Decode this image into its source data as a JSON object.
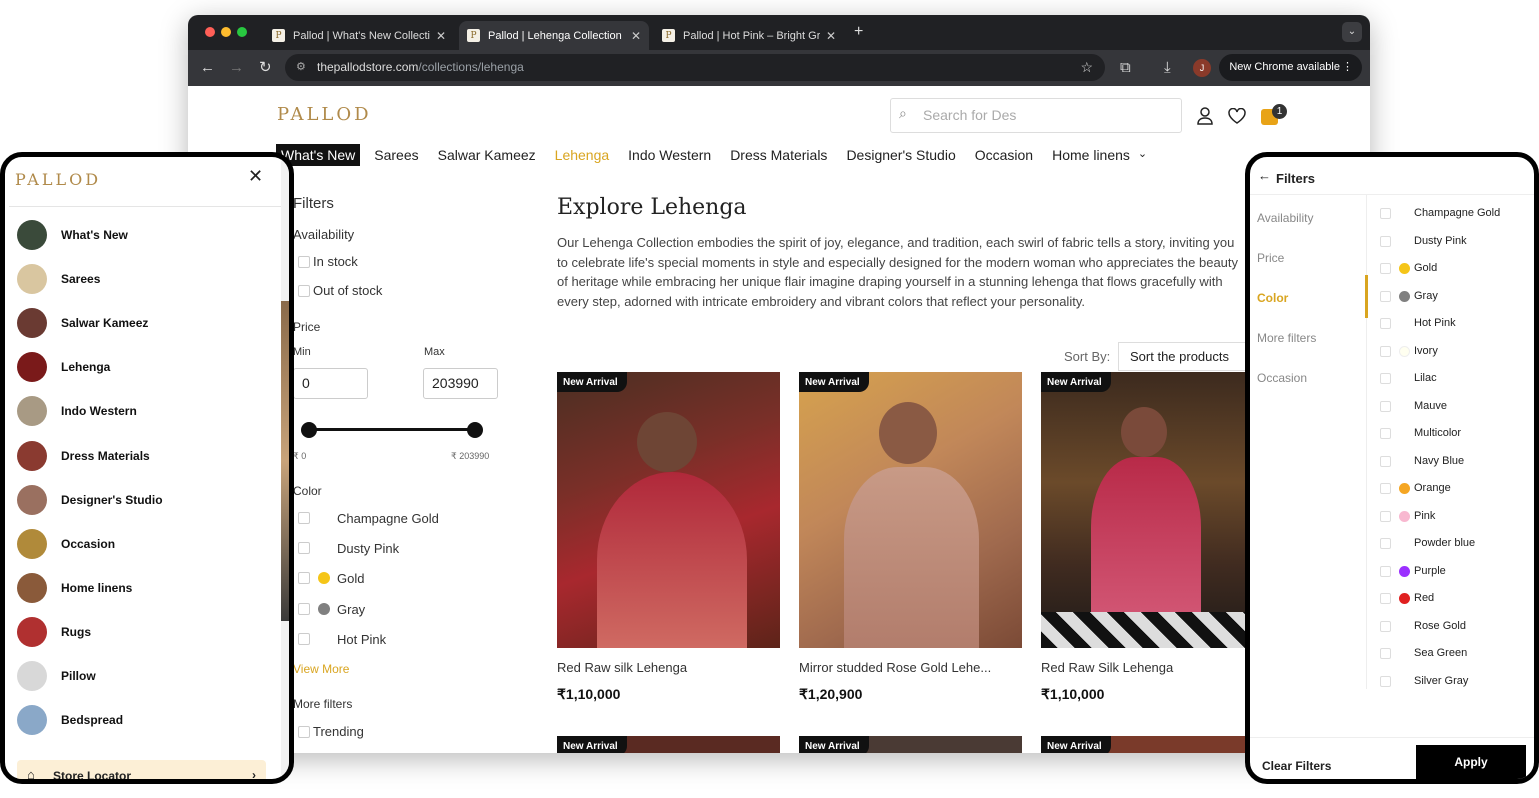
{
  "browser": {
    "tabs": [
      {
        "title": "Pallod | What's New Collectio"
      },
      {
        "title": "Pallod | Lehenga Collection"
      },
      {
        "title": "Pallod | Hot Pink – Bright Gre"
      }
    ],
    "url_host": "thepallodstore.com",
    "url_path": "/collections/lehenga",
    "profile_initial": "J",
    "new_chrome": "New Chrome available"
  },
  "site": {
    "logo": "PALLOD",
    "search_placeholder": "Search for Des",
    "cart_count": "1",
    "nav": [
      "What's New",
      "Sarees",
      "Salwar Kameez",
      "Lehenga",
      "Indo Western",
      "Dress Materials",
      "Designer's Studio",
      "Occasion",
      "Home linens"
    ]
  },
  "filters": {
    "title": "Filters",
    "availability_label": "Availability",
    "in_stock": "In stock",
    "out_of_stock": "Out of stock",
    "price_label": "Price",
    "min_label": "Min",
    "max_label": "Max",
    "min_value": "0",
    "max_value": "203990",
    "min_caption": "₹ 0",
    "max_caption": "₹ 203990",
    "color_label": "Color",
    "colors": [
      {
        "name": "Champagne Gold",
        "swatch": ""
      },
      {
        "name": "Dusty Pink",
        "swatch": ""
      },
      {
        "name": "Gold",
        "swatch": "#f5c518"
      },
      {
        "name": "Gray",
        "swatch": "#808080"
      },
      {
        "name": "Hot Pink",
        "swatch": ""
      }
    ],
    "view_more": "View More",
    "more_filters_label": "More filters",
    "trending": "Trending"
  },
  "main": {
    "heading": "Explore Lehenga",
    "description": "Our Lehenga Collection embodies the spirit of joy, elegance, and tradition, each swirl of fabric tells a story, inviting you to celebrate life's special moments in style and especially designed for the modern woman who appreciates the beauty of heritage while embracing her unique flair imagine draping yourself in a stunning lehenga that flows gracefully with every step, adorned with intricate embroidery and vibrant colors that reflect your personality.",
    "sort_label": "Sort By:",
    "sort_value": "Sort the products",
    "badge": "New Arrival",
    "products": [
      {
        "name": "Red Raw silk Lehenga",
        "price": "₹1,10,000"
      },
      {
        "name": "Mirror studded Rose Gold Lehe...",
        "price": "₹1,20,900"
      },
      {
        "name": "Red Raw Silk Lehenga",
        "price": "₹1,10,000"
      }
    ]
  },
  "mobile_menu": {
    "logo": "PALLOD",
    "items": [
      "What's New",
      "Sarees",
      "Salwar Kameez",
      "Lehenga",
      "Indo Western",
      "Dress Materials",
      "Designer's Studio",
      "Occasion",
      "Home linens",
      "Rugs",
      "Pillow",
      "Bedspread"
    ],
    "store_locator": "Store Locator"
  },
  "mobile_filters": {
    "title": "Filters",
    "tabs": [
      "Availability",
      "Price",
      "Color",
      "More filters",
      "Occasion"
    ],
    "active_tab": "Color",
    "colors": [
      {
        "name": "Champagne Gold",
        "swatch": ""
      },
      {
        "name": "Dusty Pink",
        "swatch": ""
      },
      {
        "name": "Gold",
        "swatch": "#f5c518"
      },
      {
        "name": "Gray",
        "swatch": "#808080"
      },
      {
        "name": "Hot Pink",
        "swatch": ""
      },
      {
        "name": "Ivory",
        "swatch": "#fffff0"
      },
      {
        "name": "Lilac",
        "swatch": ""
      },
      {
        "name": "Mauve",
        "swatch": ""
      },
      {
        "name": "Multicolor",
        "swatch": ""
      },
      {
        "name": "Navy Blue",
        "swatch": ""
      },
      {
        "name": "Orange",
        "swatch": "#f5a623"
      },
      {
        "name": "Pink",
        "swatch": "#f8b8d0"
      },
      {
        "name": "Powder blue",
        "swatch": ""
      },
      {
        "name": "Purple",
        "swatch": "#9b30ff"
      },
      {
        "name": "Red",
        "swatch": "#e02020"
      },
      {
        "name": "Rose Gold",
        "swatch": ""
      },
      {
        "name": "Sea Green",
        "swatch": ""
      },
      {
        "name": "Silver Gray",
        "swatch": ""
      }
    ],
    "clear": "Clear Filters",
    "apply": "Apply"
  },
  "colors": {
    "accent": "#d9a520",
    "logo": "#b08a4a"
  }
}
